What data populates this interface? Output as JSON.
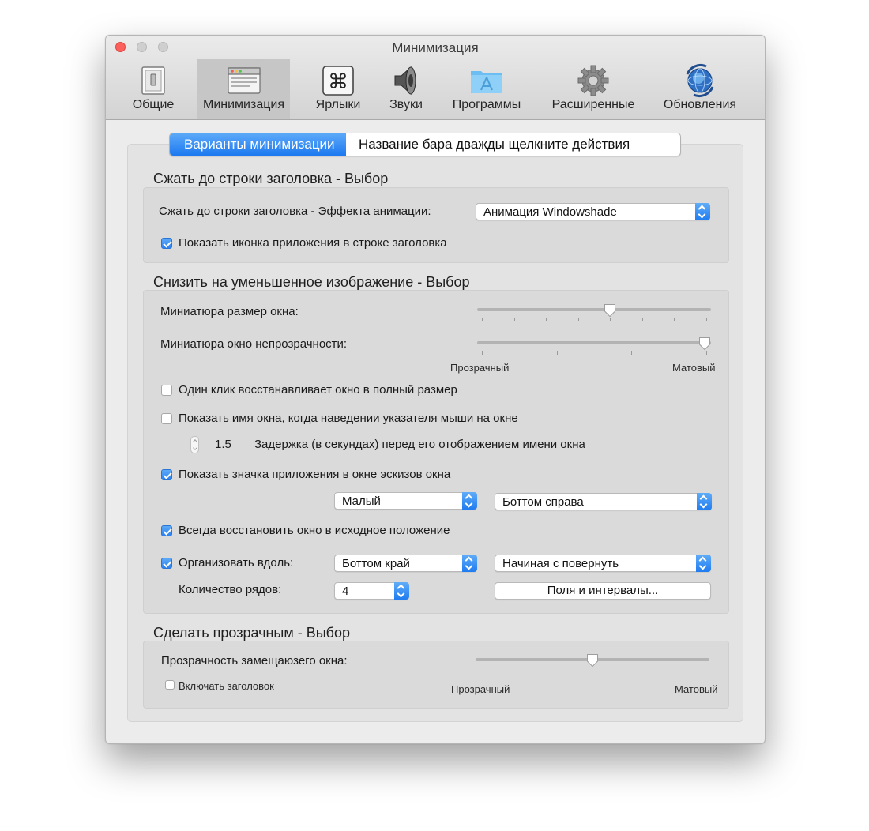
{
  "window": {
    "title": "Минимизация"
  },
  "toolbar": {
    "items": [
      {
        "label": "Общие",
        "icon": "switch-icon",
        "active": false
      },
      {
        "label": "Минимизация",
        "icon": "window-icon",
        "active": true
      },
      {
        "label": "Ярлыки",
        "icon": "command-key-icon",
        "active": false
      },
      {
        "label": "Звуки",
        "icon": "speaker-icon",
        "active": false
      },
      {
        "label": "Программы",
        "icon": "applications-folder-icon",
        "active": false
      },
      {
        "label": "Расширенные",
        "icon": "gear-icon",
        "active": false
      },
      {
        "label": "Обновления",
        "icon": "update-globe-icon",
        "active": false
      }
    ]
  },
  "tabs": [
    {
      "label": "Варианты минимизации",
      "selected": true
    },
    {
      "label": "Название бара дважды щелкните действия",
      "selected": false
    }
  ],
  "section_shade": {
    "title": "Сжать до строки заголовка - Выбор",
    "animation_label": "Сжать до строки заголовка - Эффекта анимации:",
    "animation_value": "Анимация Windowshade",
    "show_icon_label": "Показать иконка приложения в строке заголовка",
    "show_icon_checked": true
  },
  "section_thumb": {
    "title": "Снизить на уменьшенное изображение - Выбор",
    "size_label": "Миниатюра размер окна:",
    "size_level": 0.57,
    "size_ticks": 8,
    "opacity_label": "Миниатюра окно непрозрачности:",
    "opacity_level": 1.0,
    "opacity_ticks": 4,
    "min_label": "Прозрачный",
    "max_label": "Матовый",
    "one_click_label": "Один клик восстанавливает окно в полный размер",
    "one_click_checked": false,
    "show_name_label": "Показать имя окна, когда наведении указателя мыши на окне",
    "show_name_checked": false,
    "delay_value": "1.5",
    "delay_label": "Задержка (в секундах) перед его отображением имени окна",
    "show_badge_label": "Показать значка приложения в окне эскизов окна",
    "show_badge_checked": true,
    "badge_size_value": "Малый",
    "badge_position_value": "Боттом справа",
    "restore_label": "Всегда восстановить окно в исходное положение",
    "restore_checked": true,
    "arrange_label": "Организовать вдоль:",
    "arrange_checked": true,
    "arrange_edge_value": "Боттом край",
    "arrange_start_value": "Начиная с повернуть",
    "rows_label": "Количество рядов:",
    "rows_value": "4",
    "margins_button": "Поля и интервалы..."
  },
  "section_transparent": {
    "title": "Сделать прозрачным - Выбор",
    "opacity_label": "Прозрачность замещаюзего окна:",
    "opacity_level": 0.5,
    "min_label": "Прозрачный",
    "max_label": "Матовый",
    "include_title_label": "Включать заголовок",
    "include_title_checked": false
  }
}
